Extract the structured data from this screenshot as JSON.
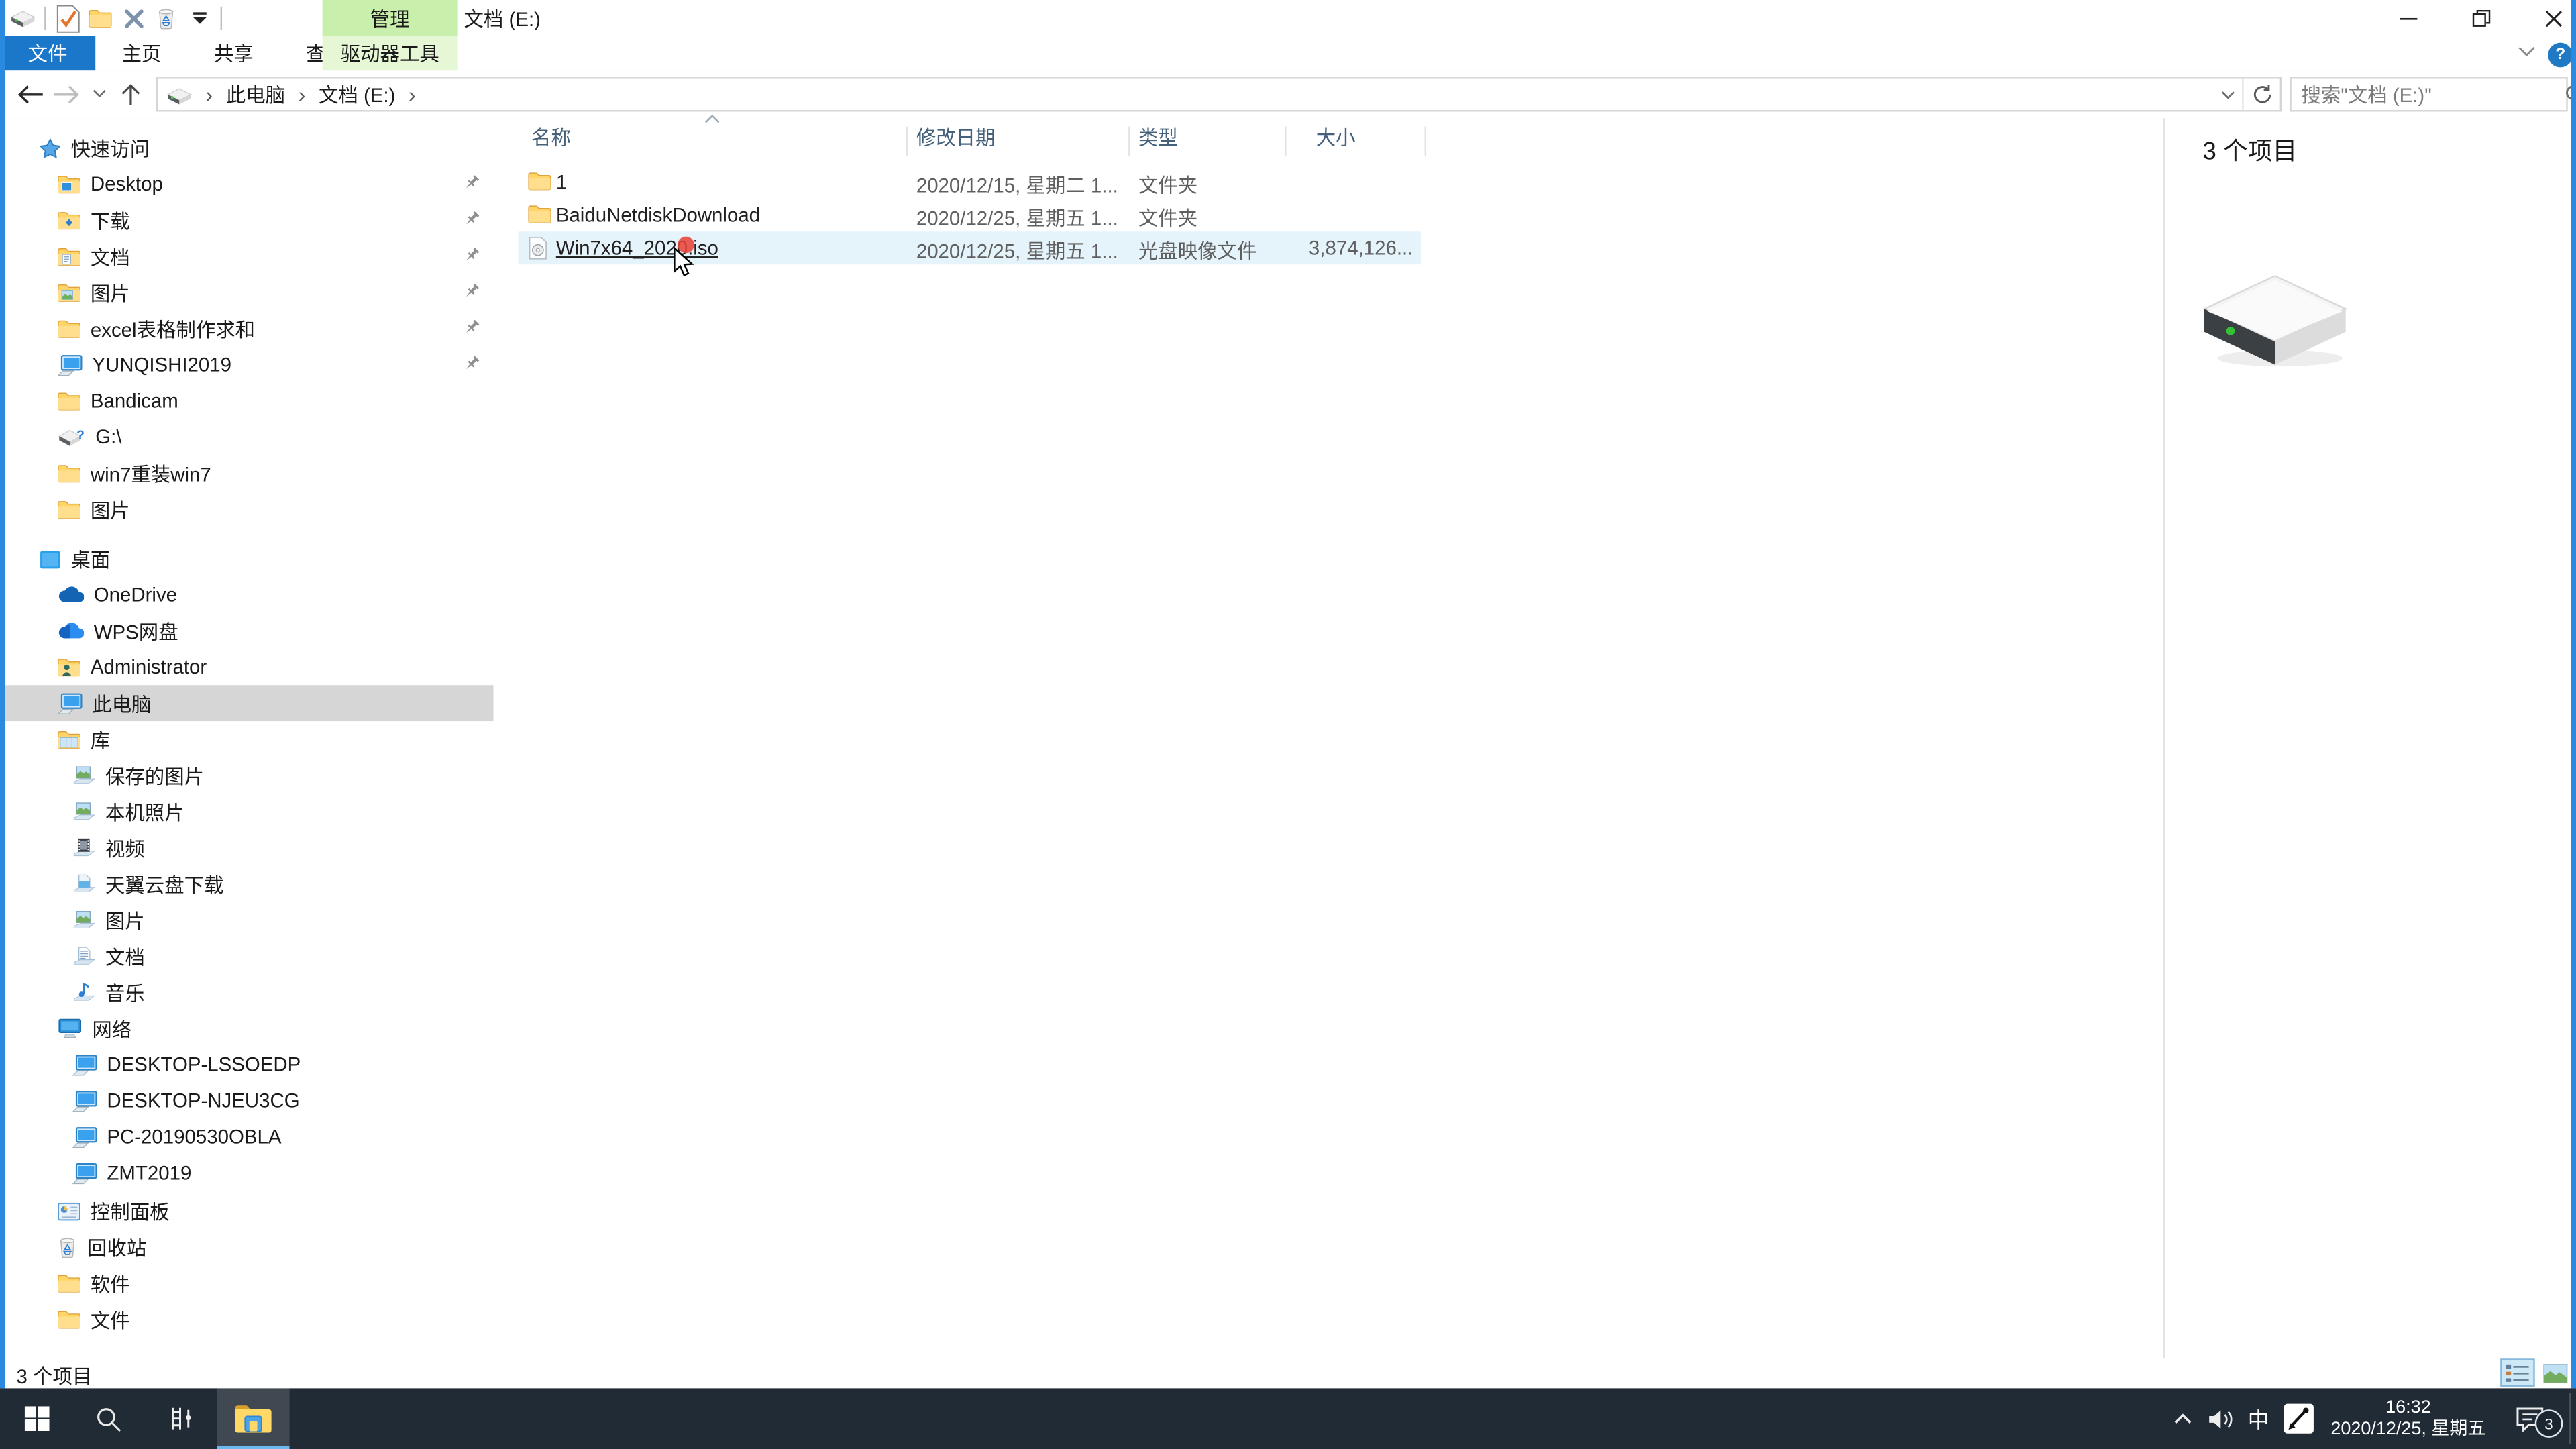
{
  "window": {
    "title": "文档 (E:)",
    "contextual_group": "管理",
    "controls": [
      "minimize",
      "restore",
      "close"
    ]
  },
  "quick_access_toolbar": {
    "items": [
      "drive",
      "separator",
      "properties",
      "new-folder",
      "delete",
      "recycle",
      "dropdown",
      "separator"
    ]
  },
  "ribbon_tabs": [
    {
      "label": "文件",
      "style": "file"
    },
    {
      "label": "主页",
      "style": "normal"
    },
    {
      "label": "共享",
      "style": "normal"
    },
    {
      "label": "查看",
      "style": "normal"
    },
    {
      "label": "驱动器工具",
      "style": "contextual"
    }
  ],
  "address_bar": {
    "breadcrumb_icon": "drive",
    "breadcrumb": [
      "此电脑",
      "文档 (E:)"
    ],
    "search_placeholder": "搜索\"文档 (E:)\""
  },
  "list": {
    "columns": [
      {
        "label": "名称",
        "sorted": true
      },
      {
        "label": "修改日期",
        "sorted": false
      },
      {
        "label": "类型",
        "sorted": false
      },
      {
        "label": "大小",
        "sorted": false
      }
    ],
    "files": [
      {
        "name": "1",
        "icon": "folder",
        "date": "2020/12/15, 星期二 1...",
        "type": "文件夹",
        "size": "",
        "hover": false
      },
      {
        "name": "BaiduNetdiskDownload",
        "icon": "folder",
        "date": "2020/12/25, 星期五 1...",
        "type": "文件夹",
        "size": "",
        "hover": false
      },
      {
        "name": "Win7x64_2020.iso",
        "icon": "iso",
        "date": "2020/12/25, 星期五 1...",
        "type": "光盘映像文件",
        "size": "3,874,126...",
        "hover": true
      }
    ]
  },
  "sidebar": {
    "items": [
      {
        "label": "快速访问",
        "icon": "star",
        "indent": 0,
        "pinned": false,
        "selected": false,
        "gap_before": 0
      },
      {
        "label": "Desktop",
        "icon": "folder-desktop",
        "indent": 1,
        "pinned": true,
        "selected": false,
        "gap_before": 0
      },
      {
        "label": "下载",
        "icon": "folder-download",
        "indent": 1,
        "pinned": true,
        "selected": false,
        "gap_before": 0
      },
      {
        "label": "文档",
        "icon": "folder-doc",
        "indent": 1,
        "pinned": true,
        "selected": false,
        "gap_before": 0
      },
      {
        "label": "图片",
        "icon": "folder-pic",
        "indent": 1,
        "pinned": true,
        "selected": false,
        "gap_before": 0
      },
      {
        "label": "excel表格制作求和",
        "icon": "folder",
        "indent": 1,
        "pinned": true,
        "selected": false,
        "gap_before": 0
      },
      {
        "label": "YUNQISHI2019",
        "icon": "computer",
        "indent": 1,
        "pinned": true,
        "selected": false,
        "gap_before": 0
      },
      {
        "label": "Bandicam",
        "icon": "folder",
        "indent": 1,
        "pinned": false,
        "selected": false,
        "gap_before": 0
      },
      {
        "label": "G:\\",
        "icon": "drive-q",
        "indent": 1,
        "pinned": false,
        "selected": false,
        "gap_before": 0
      },
      {
        "label": "win7重装win7",
        "icon": "folder",
        "indent": 1,
        "pinned": false,
        "selected": false,
        "gap_before": 0
      },
      {
        "label": "图片",
        "icon": "folder",
        "indent": 1,
        "pinned": false,
        "selected": false,
        "gap_before": 0
      },
      {
        "label": "桌面",
        "icon": "desktop",
        "indent": 0,
        "pinned": false,
        "selected": false,
        "gap_before": 8
      },
      {
        "label": "OneDrive",
        "icon": "onedrive",
        "indent": 1,
        "pinned": false,
        "selected": false,
        "gap_before": 0
      },
      {
        "label": "WPS网盘",
        "icon": "wps",
        "indent": 1,
        "pinned": false,
        "selected": false,
        "gap_before": 0
      },
      {
        "label": "Administrator",
        "icon": "folder-user",
        "indent": 1,
        "pinned": false,
        "selected": false,
        "gap_before": 0
      },
      {
        "label": "此电脑",
        "icon": "computer",
        "indent": 1,
        "pinned": false,
        "selected": true,
        "gap_before": 0
      },
      {
        "label": "库",
        "icon": "library",
        "indent": 1,
        "pinned": false,
        "selected": false,
        "gap_before": 0
      },
      {
        "label": "保存的图片",
        "icon": "lib-pic",
        "indent": 2,
        "pinned": false,
        "selected": false,
        "gap_before": 0
      },
      {
        "label": "本机照片",
        "icon": "lib-pic",
        "indent": 2,
        "pinned": false,
        "selected": false,
        "gap_before": 0
      },
      {
        "label": "视频",
        "icon": "lib-video",
        "indent": 2,
        "pinned": false,
        "selected": false,
        "gap_before": 0
      },
      {
        "label": "天翼云盘下载",
        "icon": "lib-download",
        "indent": 2,
        "pinned": false,
        "selected": false,
        "gap_before": 0
      },
      {
        "label": "图片",
        "icon": "lib-pic",
        "indent": 2,
        "pinned": false,
        "selected": false,
        "gap_before": 0
      },
      {
        "label": "文档",
        "icon": "lib-doc",
        "indent": 2,
        "pinned": false,
        "selected": false,
        "gap_before": 0
      },
      {
        "label": "音乐",
        "icon": "lib-music",
        "indent": 2,
        "pinned": false,
        "selected": false,
        "gap_before": 0
      },
      {
        "label": "网络",
        "icon": "network",
        "indent": 1,
        "pinned": false,
        "selected": false,
        "gap_before": 0
      },
      {
        "label": "DESKTOP-LSSOEDP",
        "icon": "computer",
        "indent": 2,
        "pinned": false,
        "selected": false,
        "gap_before": 0
      },
      {
        "label": "DESKTOP-NJEU3CG",
        "icon": "computer",
        "indent": 2,
        "pinned": false,
        "selected": false,
        "gap_before": 0
      },
      {
        "label": "PC-20190530OBLA",
        "icon": "computer",
        "indent": 2,
        "pinned": false,
        "selected": false,
        "gap_before": 0
      },
      {
        "label": "ZMT2019",
        "icon": "computer",
        "indent": 2,
        "pinned": false,
        "selected": false,
        "gap_before": 0
      },
      {
        "label": "控制面板",
        "icon": "control",
        "indent": 1,
        "pinned": false,
        "selected": false,
        "gap_before": 1
      },
      {
        "label": "回收站",
        "icon": "recycle",
        "indent": 1,
        "pinned": false,
        "selected": false,
        "gap_before": 0
      },
      {
        "label": "软件",
        "icon": "folder",
        "indent": 1,
        "pinned": false,
        "selected": false,
        "gap_before": 0
      },
      {
        "label": "文件",
        "icon": "folder",
        "indent": 1,
        "pinned": false,
        "selected": false,
        "gap_before": 0
      }
    ]
  },
  "preview": {
    "header": "3 个项目",
    "icon": "drive-large"
  },
  "status": {
    "items_text": "3 个项目",
    "view_buttons": [
      "details-view",
      "thumbnail-view"
    ]
  },
  "taskbar": {
    "buttons": [
      "start",
      "search",
      "task-view",
      "file-explorer"
    ],
    "active_button": "file-explorer",
    "ime_mode": "中",
    "time": "16:32",
    "date": "2020/12/25, 星期五",
    "badge": "3"
  },
  "overlay": {
    "pointer": "cursor-icon",
    "click_dot_color": "#e8443a"
  },
  "colors": {
    "accent_blue": "#1b77c9",
    "contextual_green": "#c9efad",
    "hover_row": "#e5f3fb",
    "taskbar_bg": "#212b35",
    "window_border": "#2a8ae0"
  }
}
